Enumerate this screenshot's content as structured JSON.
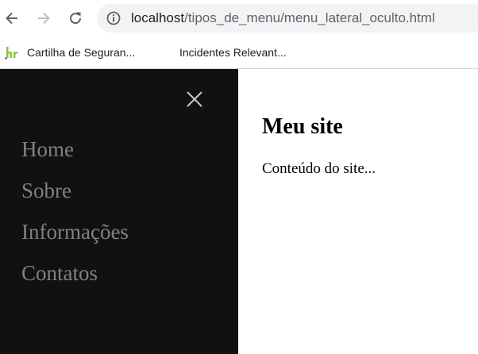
{
  "browser": {
    "url": {
      "host": "localhost",
      "path": "/tipos_de_menu/menu_lateral_oculto.html"
    },
    "icons": {
      "back": "arrow-left-icon",
      "forward": "arrow-right-icon",
      "reload": "reload-icon",
      "site_info": "info-circle-icon"
    },
    "bookmarks": [
      {
        "label": "Cartilha de Seguran...",
        "icon": "br-logo-icon"
      },
      {
        "label": "Incidentes Relevant..."
      }
    ]
  },
  "sidenav": {
    "close_icon": "close-icon",
    "items": [
      {
        "label": "Home"
      },
      {
        "label": "Sobre"
      },
      {
        "label": "Informações"
      },
      {
        "label": "Contatos"
      }
    ]
  },
  "main": {
    "title": "Meu site",
    "content": "Conteúdo do site..."
  },
  "colors": {
    "sidenav_bg": "#111111",
    "nav_link": "#818181",
    "omnibox_bg": "#f1f3f4",
    "br_logo": "#8dc63f"
  }
}
